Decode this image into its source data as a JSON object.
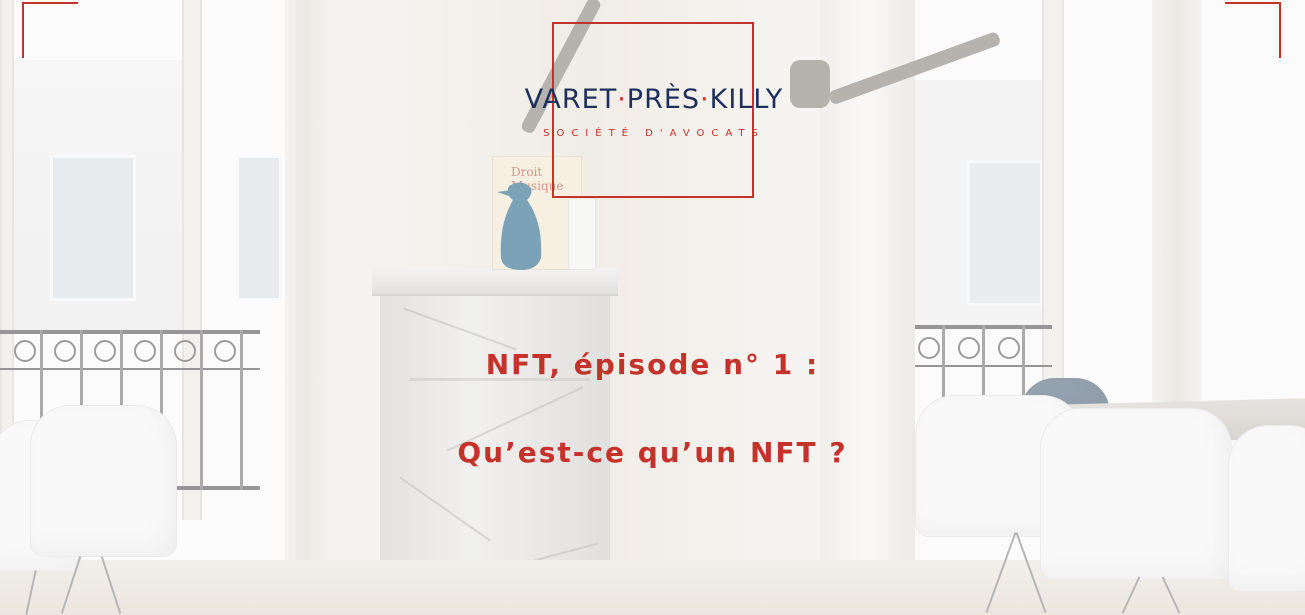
{
  "logo": {
    "name_part1": "VARET",
    "name_part2": "PRÈS",
    "name_part3": "KILLY",
    "separator": "·",
    "subtitle": "SOCIÉTÉ D'AVOCATS"
  },
  "mantel_book": {
    "title": "Droit Musique"
  },
  "titles": {
    "line1": "NFT, épisode n° 1 :",
    "line2": "Qu’est-ce qu’un NFT ?"
  },
  "colors": {
    "accent": "#c4322c",
    "brand_navy": "#1f2f5b",
    "penguin": "#4a7f9b"
  },
  "icons": {
    "corner_left": "corner-bracket-icon",
    "corner_right": "corner-bracket-icon"
  }
}
